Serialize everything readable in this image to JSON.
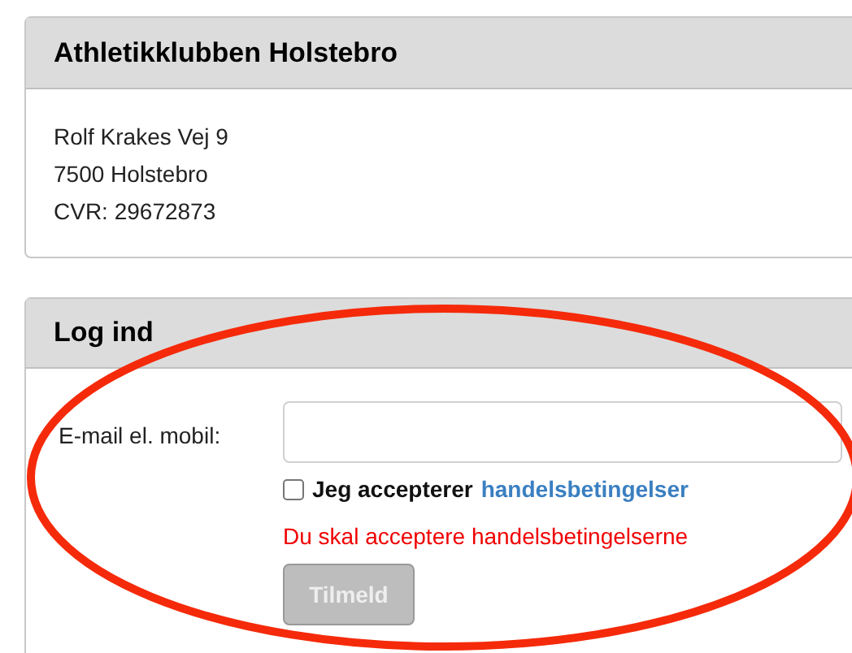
{
  "club_panel": {
    "title": "Athletikklubben Holstebro",
    "lines": [
      "Rolf Krakes Vej 9",
      "7500 Holstebro",
      "CVR: 29672873"
    ]
  },
  "login_panel": {
    "title": "Log ind",
    "email_label": "E-mail el. mobil:",
    "terms": {
      "checked": false,
      "text": "Jeg accepterer",
      "link": "handelsbetingelser"
    },
    "error": "Du skal acceptere handelsbetingelserne",
    "submit": {
      "label": "Tilmeld",
      "disabled": true
    }
  }
}
